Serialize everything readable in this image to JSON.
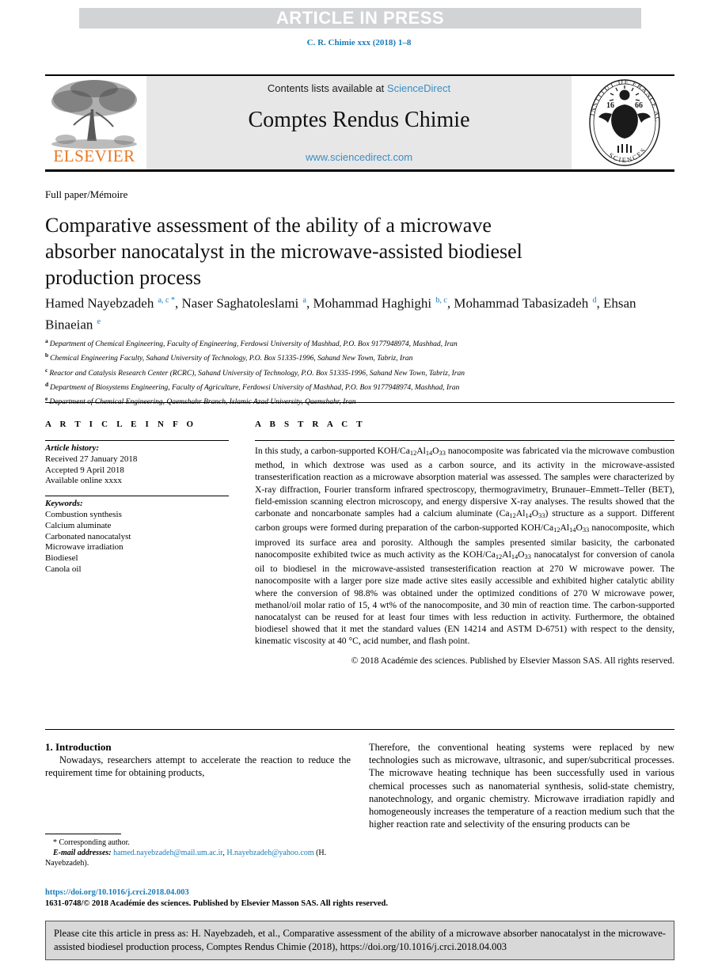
{
  "banner": {
    "article_in_press": "ARTICLE IN PRESS",
    "journal_ref": "C. R. Chimie xxx (2018) 1–8"
  },
  "masthead": {
    "contents_prefix": "Contents lists available at ",
    "sciencedirect_link": "ScienceDirect",
    "journal_title": "Comptes Rendus Chimie",
    "sciencedirect_url": "www.sciencedirect.com",
    "elsevier_wordmark": "ELSEVIER",
    "publisher_logo_name": "elsevier-tree-logo",
    "academy_logo_name": "academie-des-sciences-seal"
  },
  "article": {
    "type": "Full paper/Mémoire",
    "title": "Comparative assessment of the ability of a microwave absorber nanocatalyst in the microwave-assisted biodiesel production process",
    "authors": [
      {
        "name": "Hamed Nayebzadeh",
        "marks": "a, c",
        "corresponding": "*",
        "sep": ", "
      },
      {
        "name": "Naser Saghatoleslami",
        "marks": "a",
        "corresponding": "",
        "sep": ", "
      },
      {
        "name": "Mohammad Haghighi",
        "marks": "b, c",
        "corresponding": "",
        "sep": ", "
      },
      {
        "name": "Mohammad Tabasizadeh",
        "marks": "d",
        "corresponding": "",
        "sep": ", "
      },
      {
        "name": "Ehsan Binaeian",
        "marks": "e",
        "corresponding": "",
        "sep": ""
      }
    ],
    "affiliations": [
      {
        "mark": "a",
        "text": "Department of Chemical Engineering, Faculty of Engineering, Ferdowsi University of Mashhad, P.O. Box 9177948974, Mashhad, Iran"
      },
      {
        "mark": "b",
        "text": "Chemical Engineering Faculty, Sahand University of Technology, P.O. Box 51335-1996, Sahand New Town, Tabriz, Iran"
      },
      {
        "mark": "c",
        "text": "Reactor and Catalysis Research Center (RCRC), Sahand University of Technology, P.O. Box 51335-1996, Sahand New Town, Tabriz, Iran"
      },
      {
        "mark": "d",
        "text": "Department of Biosystems Engineering, Faculty of Agriculture, Ferdowsi University of Mashhad, P.O. Box 9177948974, Mashhad, Iran"
      },
      {
        "mark": "e",
        "text": "Department of Chemical Engineering, Qaemshahr Branch, Islamic Azad University, Qaemshahr, Iran"
      }
    ]
  },
  "article_info": {
    "heading": "A R T I C L E   I N F O",
    "history_label": "Article history:",
    "history": [
      "Received 27 January 2018",
      "Accepted 9 April 2018",
      "Available online xxxx"
    ],
    "keywords_label": "Keywords:",
    "keywords": [
      "Combustion synthesis",
      "Calcium aluminate",
      "Carbonated nanocatalyst",
      "Microwave irradiation",
      "Biodiesel",
      "Canola oil"
    ]
  },
  "abstract": {
    "heading": "A B S T R A C T",
    "paragraph_html": "In this study, a carbon-supported KOH/Ca<sub>12</sub>Al<sub>14</sub>O<sub>33</sub> nanocomposite was fabricated via the microwave combustion method, in which dextrose was used as a carbon source, and its activity in the microwave-assisted transesterification reaction as a microwave absorption material was assessed. The samples were characterized by X-ray diffraction, Fourier transform infrared spectroscopy, thermogravimetry, Brunauer–Emmett–Teller (BET), field-emission scanning electron microscopy, and energy dispersive X-ray analyses. The results showed that the carbonate and noncarbonate samples had a calcium aluminate (Ca<sub>12</sub>Al<sub>14</sub>O<sub>33</sub>) structure as a support. Different carbon groups were formed during preparation of the carbon-supported KOH/Ca<sub>12</sub>Al<sub>14</sub>O<sub>33</sub> nanocomposite, which improved its surface area and porosity. Although the samples presented similar basicity, the carbonated nanocomposite exhibited twice as much activity as the KOH/Ca<sub>12</sub>Al<sub>14</sub>O<sub>33</sub> nanocatalyst for conversion of canola oil to biodiesel in the microwave-assisted transesterification reaction at 270 W microwave power. The nanocomposite with a larger pore size made active sites easily accessible and exhibited higher catalytic ability where the conversion of 98.8% was obtained under the optimized conditions of 270 W microwave power, methanol/oil molar ratio of 15, 4 wt% of the nanocomposite, and 30 min of reaction time. The carbon-supported nanocatalyst can be reused for at least four times with less reduction in activity. Furthermore, the obtained biodiesel showed that it met the standard values (EN 14214 and ASTM D-6751) with respect to the density, kinematic viscosity at 40 °C, acid number, and flash point.",
    "copyright": "© 2018 Académie des sciences. Published by Elsevier Masson SAS. All rights reserved."
  },
  "body": {
    "section_number_title": "1. Introduction",
    "left_paragraph": "Nowadays, researchers attempt to accelerate the reaction to reduce the requirement time for obtaining products,",
    "right_paragraph": "Therefore, the conventional heating systems were replaced by new technologies such as microwave, ultrasonic, and super/subcritical processes. The microwave heating technique has been successfully used in various chemical processes such as nanomaterial synthesis, solid-state chemistry, nanotechnology, and organic chemistry. Microwave irradiation rapidly and homogeneously increases the temperature of a reaction medium such that the higher reaction rate and selectivity of the ensuring products can be"
  },
  "footnote": {
    "corresponding_marker": "*",
    "corresponding_text": "Corresponding author.",
    "email_label": "E-mail addresses:",
    "email_1": "hamed.nayebzadeh@mail.um.ac.ir",
    "email_separator": ", ",
    "email_2": "H.nayebzadeh@yahoo.com",
    "email_owner": " (H. Nayebzadeh)."
  },
  "footer": {
    "doi": "https://doi.org/10.1016/j.crci.2018.04.003",
    "issn_copyright": "1631-0748/© 2018 Académie des sciences. Published by Elsevier Masson SAS. All rights reserved.",
    "citation_notice": "Please cite this article in press as: H. Nayebzadeh, et al., Comparative assessment of the ability of a microwave absorber nanocatalyst in the microwave-assisted biodiesel production process, Comptes Rendus Chimie (2018), https://doi.org/10.1016/j.crci.2018.04.003"
  },
  "colors": {
    "link_blue": "#1a7bb9",
    "sciencedirect_blue": "#3a8ec4",
    "elsevier_orange": "#e87722",
    "banner_gray": "#d2d3d5",
    "masthead_gray": "#e7e7e7",
    "cite_box_gray": "#d8d8d8"
  }
}
